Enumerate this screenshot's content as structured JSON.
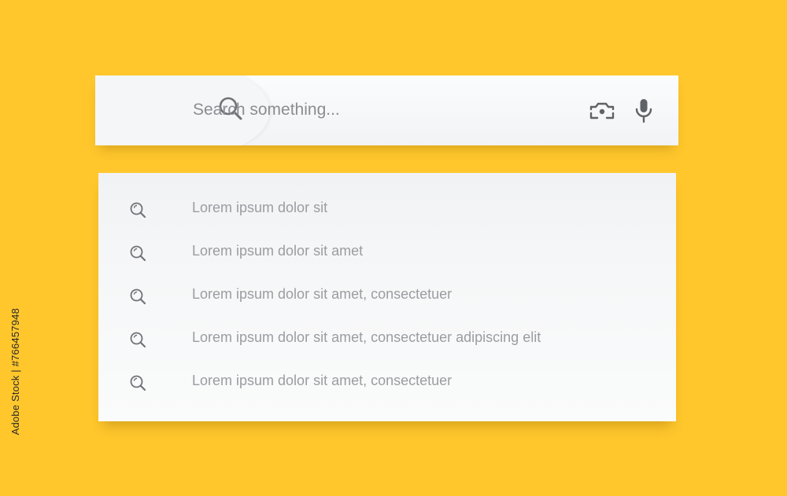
{
  "colors": {
    "background": "#FFC72C",
    "panel": "#F4F5F7",
    "icon": "#707378",
    "text": "#9A9DA1"
  },
  "search": {
    "placeholder": "Search something...",
    "value": "",
    "search_icon": "magnifier-icon",
    "camera_icon": "camera-icon",
    "mic_icon": "microphone-icon"
  },
  "suggestions": [
    {
      "icon": "magnifier-icon",
      "label": "Lorem ipsum dolor sit"
    },
    {
      "icon": "magnifier-icon",
      "label": "Lorem ipsum dolor sit amet"
    },
    {
      "icon": "magnifier-icon",
      "label": "Lorem ipsum dolor sit amet, consectetuer"
    },
    {
      "icon": "magnifier-icon",
      "label": "Lorem ipsum dolor sit amet, consectetuer adipiscing elit"
    },
    {
      "icon": "magnifier-icon",
      "label": "Lorem ipsum dolor sit amet, consectetuer"
    }
  ],
  "side_text": "Adobe Stock | #766457948"
}
